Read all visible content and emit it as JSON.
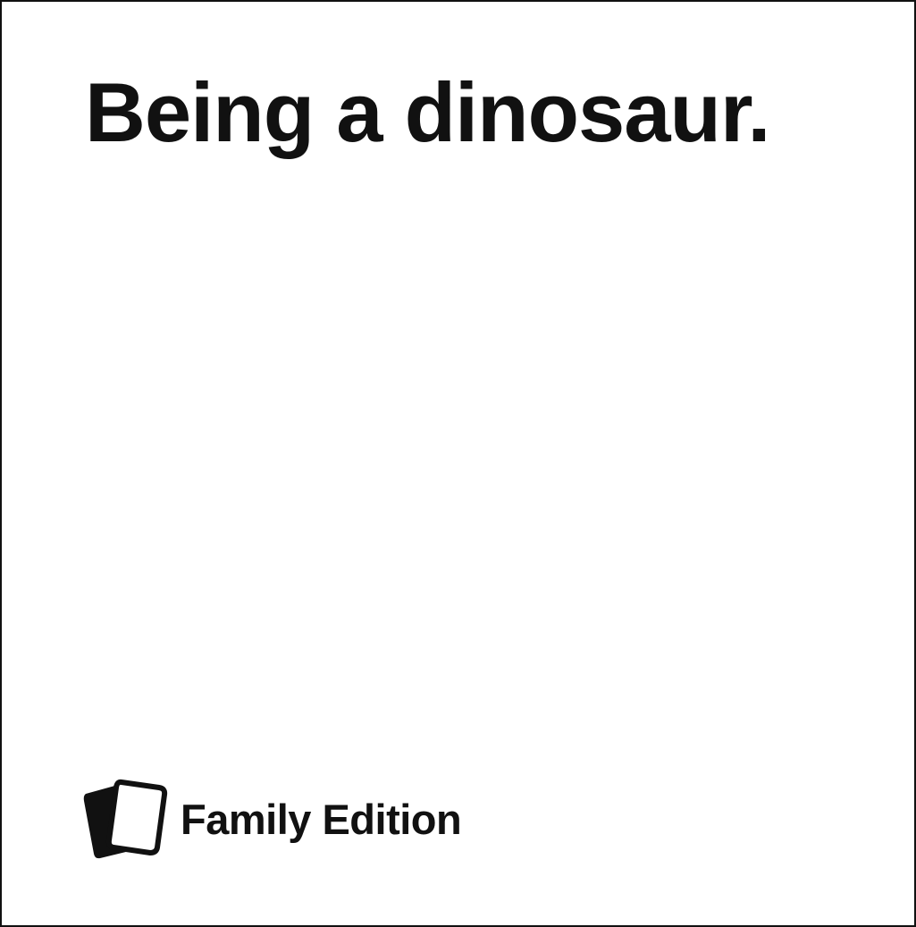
{
  "card": {
    "text": "Being a dinosaur.",
    "edition_label": "Family Edition",
    "edition_icon": "stacked-cards-icon"
  },
  "colors": {
    "ink": "#111111",
    "background": "#ffffff"
  }
}
